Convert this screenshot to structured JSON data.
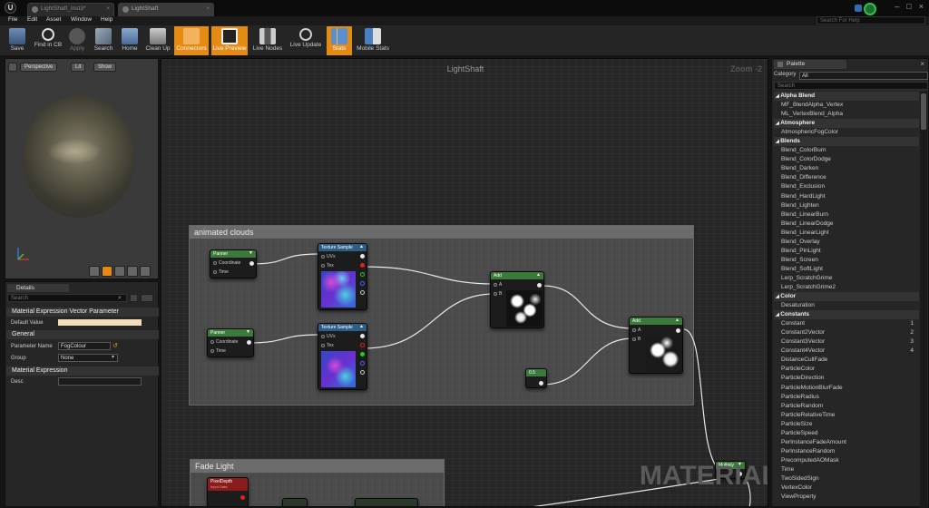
{
  "titlebar": {
    "tabs": [
      "LightShaft_Inst3*",
      "LightShaft"
    ],
    "logo": "U"
  },
  "menu": [
    "File",
    "Edit",
    "Asset",
    "Window",
    "Help"
  ],
  "search_help_placeholder": "Search For Help",
  "toolbar": [
    {
      "label": "Save",
      "icon": "save-icon",
      "active": false
    },
    {
      "label": "Find in CB",
      "icon": "find-in-cb-icon",
      "active": false
    },
    {
      "label": "Apply",
      "icon": "apply-icon",
      "active": false
    },
    {
      "label": "Search",
      "icon": "search-icon",
      "active": false
    },
    {
      "label": "Home",
      "icon": "home-icon",
      "active": false
    },
    {
      "label": "Clean Up",
      "icon": "clean-up-icon",
      "active": false
    },
    {
      "label": "Connectors",
      "icon": "connectors-icon",
      "active": true
    },
    {
      "label": "Live Preview",
      "icon": "live-preview-icon",
      "active": true
    },
    {
      "label": "Live Nodes",
      "icon": "live-nodes-icon",
      "active": false
    },
    {
      "label": "Live Update",
      "icon": "live-update-icon",
      "active": false
    },
    {
      "label": "Stats",
      "icon": "stats-icon",
      "active": true
    },
    {
      "label": "Mobile Stats",
      "icon": "mobile-stats-icon",
      "active": false
    }
  ],
  "viewport": {
    "buttons": [
      "Perspective",
      "Lit",
      "Show"
    ]
  },
  "details": {
    "tab": "Details",
    "search_placeholder": "Search",
    "header": "Material Expression Vector Parameter",
    "default_value_label": "Default Value",
    "general_label": "General",
    "param_name_label": "Parameter Name",
    "param_name_value": "FogColour",
    "group_label": "Group",
    "group_value": "None",
    "material_expression_label": "Material Expression",
    "desc_label": "Desc"
  },
  "graph": {
    "title": "LightShaft",
    "zoom": "Zoom -2",
    "watermark": "MATERIAL",
    "comments": [
      "animated clouds",
      "Fade Light"
    ],
    "nodes": {
      "panner": "Panner",
      "coordinate": "Coordinate",
      "time": "Time",
      "texture_sample": "Texture Sample",
      "uvs": "UVs",
      "tex": "Tex",
      "add": "Add",
      "a": "A",
      "b": "B",
      "constant": "0.5",
      "multiply": "Multiply",
      "pixel_depth": "PixelDepth",
      "pixel_depth_sub": "Input Data"
    }
  },
  "palette": {
    "tab": "Palette",
    "category_label": "Category",
    "category_value": "All",
    "search_placeholder": "Search",
    "items": [
      {
        "t": "Alpha Blend",
        "cat": true
      },
      {
        "t": "MF_BlendAlpha_Vertex"
      },
      {
        "t": "ML_VertexBlend_Alpha"
      },
      {
        "t": "Atmosphere",
        "cat": true
      },
      {
        "t": "AtmosphericFogColor"
      },
      {
        "t": "Blends",
        "cat": true
      },
      {
        "t": "Blend_ColorBurn"
      },
      {
        "t": "Blend_ColorDodge"
      },
      {
        "t": "Blend_Darken"
      },
      {
        "t": "Blend_Difference"
      },
      {
        "t": "Blend_Exclusion"
      },
      {
        "t": "Blend_HardLight"
      },
      {
        "t": "Blend_Lighten"
      },
      {
        "t": "Blend_LinearBurn"
      },
      {
        "t": "Blend_LinearDodge"
      },
      {
        "t": "Blend_LinearLight"
      },
      {
        "t": "Blend_Overlay"
      },
      {
        "t": "Blend_PinLight"
      },
      {
        "t": "Blend_Screen"
      },
      {
        "t": "Blend_SoftLight"
      },
      {
        "t": "Lerp_ScratchGrime"
      },
      {
        "t": "Lerp_ScratchGrime2"
      },
      {
        "t": "Color",
        "cat": true
      },
      {
        "t": "Desaturation"
      },
      {
        "t": "Constants",
        "cat": true
      },
      {
        "t": "Constant",
        "k": "1"
      },
      {
        "t": "Constant2Vector",
        "k": "2"
      },
      {
        "t": "Constant3Vector",
        "k": "3"
      },
      {
        "t": "Constant4Vector",
        "k": "4"
      },
      {
        "t": "DistanceCullFade"
      },
      {
        "t": "ParticleColor"
      },
      {
        "t": "ParticleDirection"
      },
      {
        "t": "ParticleMotionBlurFade"
      },
      {
        "t": "ParticleRadius"
      },
      {
        "t": "ParticleRandom"
      },
      {
        "t": "ParticleRelativeTime"
      },
      {
        "t": "ParticleSize"
      },
      {
        "t": "ParticleSpeed"
      },
      {
        "t": "PerInstanceFadeAmount"
      },
      {
        "t": "PerInstanceRandom"
      },
      {
        "t": "PrecomputedAOMask"
      },
      {
        "t": "Time"
      },
      {
        "t": "TwoSidedSign"
      },
      {
        "t": "VertexColor"
      },
      {
        "t": "ViewProperty"
      }
    ]
  },
  "colors": {
    "accent": "#e58a13",
    "panner_header": "#3b7a3b",
    "texture_header": "#2d5f86",
    "math_header": "#3b7a3b",
    "pixel_depth_header": "#8a1b1b",
    "default_value_swatch": "#f1ddb8"
  }
}
